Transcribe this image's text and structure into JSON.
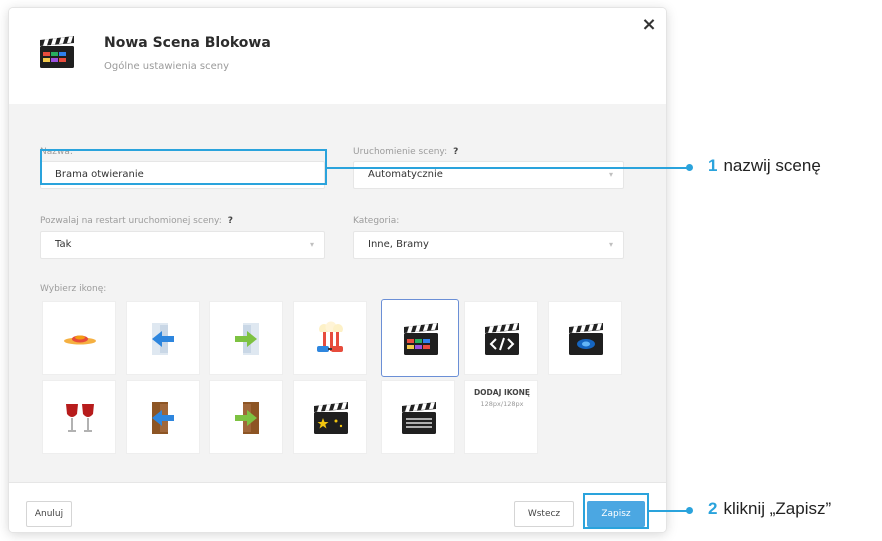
{
  "dialog": {
    "title": "Nowa Scena Blokowa",
    "subtitle": "Ogólne ustawienia sceny",
    "close_symbol": "×",
    "header_icon": "clapperboard-color-icon"
  },
  "form": {
    "name_label": "Nazwa:",
    "name_value": "Brama otwieranie",
    "launch_label": "Uruchomienie sceny:",
    "launch_help": "?",
    "launch_value": "Automatycznie",
    "restart_label": "Pozwalaj na restart uruchomionej sceny:",
    "restart_help": "?",
    "restart_value": "Tak",
    "category_label": "Kategoria:",
    "category_value": "Inne, Bramy",
    "icons_label": "Wybierz ikonę:",
    "caret_symbol": "▾"
  },
  "icons": [
    {
      "name": "lamp-icon",
      "selected": false
    },
    {
      "name": "door-enter-icon",
      "selected": false
    },
    {
      "name": "door-exit-icon",
      "selected": false
    },
    {
      "name": "popcorn-icon",
      "selected": false
    },
    {
      "name": "clapperboard-color-icon",
      "selected": true
    },
    {
      "name": "clapperboard-code-icon",
      "selected": false
    },
    {
      "name": "clapperboard-blue-icon",
      "selected": false
    },
    {
      "name": "wine-glasses-icon",
      "selected": false
    },
    {
      "name": "door-brown-enter-icon",
      "selected": false
    },
    {
      "name": "door-brown-exit-icon",
      "selected": false
    },
    {
      "name": "clapperboard-stars-icon",
      "selected": false
    },
    {
      "name": "clapperboard-plain-icon",
      "selected": false
    }
  ],
  "add_icon": {
    "title": "DODAJ IKONĘ",
    "size": "128px/128px"
  },
  "footer": {
    "cancel_label": "Anuluj",
    "back_label": "Wstecz",
    "save_label": "Zapisz"
  },
  "callouts": [
    {
      "number": "1",
      "text": "nazwij scenę"
    },
    {
      "number": "2",
      "text": "kliknij „Zapisz”"
    }
  ],
  "colors": {
    "accent": "#2aa3dc",
    "primary_button": "#4ba7e2"
  }
}
